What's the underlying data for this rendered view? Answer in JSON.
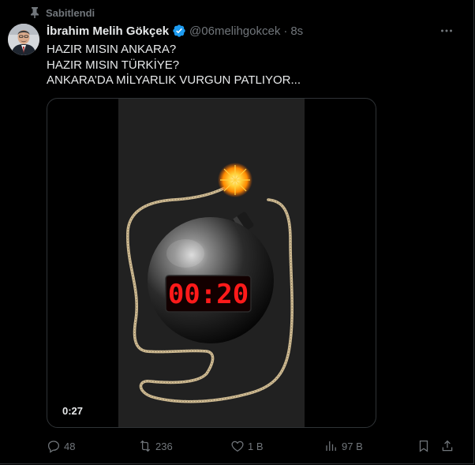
{
  "pinned": {
    "label": "Sabitlendi",
    "icon": "pin-icon"
  },
  "author": {
    "name": "İbrahim Melih Gökçek",
    "handle": "@06melihgokcek",
    "separator": "·",
    "time": "8s",
    "verified": true,
    "verified_color": "#1d9bf0"
  },
  "tweet": {
    "lines": [
      "HAZIR MISIN ANKARA?",
      "HAZIR MISIN TÜRKİYE?",
      "ANKARA’DA MİLYARLIK VURGUN PATLIYOR..."
    ]
  },
  "video": {
    "duration": "0:27",
    "timer_display": "00:20",
    "timer_color": "#ff1a1a"
  },
  "actions": {
    "replies": "48",
    "retweets": "236",
    "likes": "1 B",
    "views": "97 B"
  },
  "colors": {
    "background": "#000000",
    "text": "#e7e9ea",
    "muted": "#71767b",
    "border": "#2f3336"
  }
}
